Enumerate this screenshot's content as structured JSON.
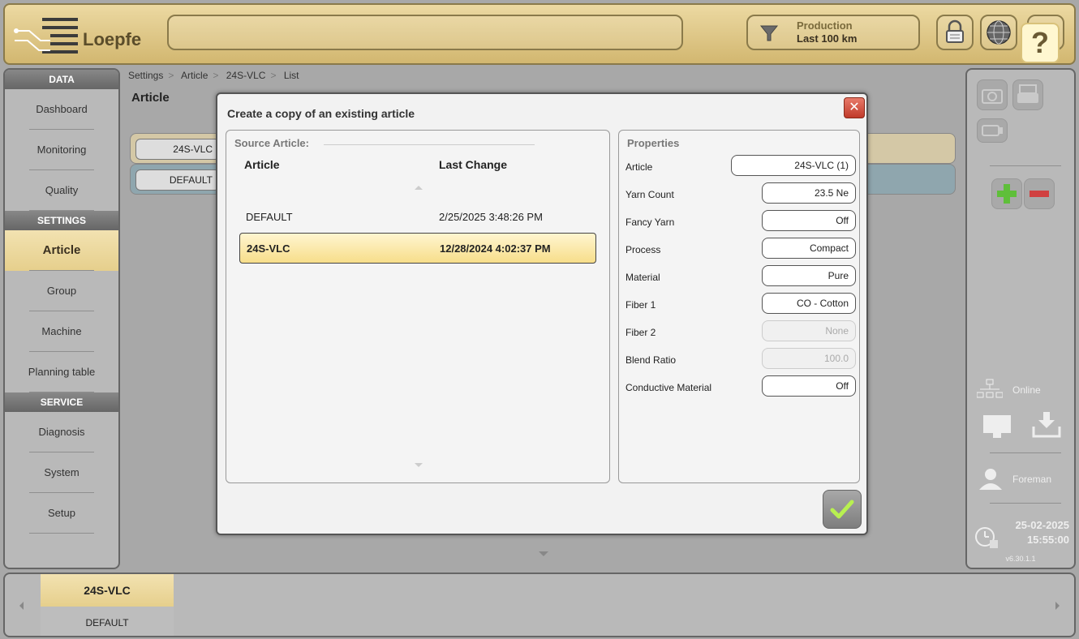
{
  "brand": {
    "name": "Loepfe"
  },
  "topbar": {
    "search_value": "",
    "filter_line1": "Production",
    "filter_line2": "Last 100 km",
    "help_label": "?"
  },
  "sidebar": {
    "sections": [
      {
        "header": "DATA",
        "items": [
          {
            "label": "Dashboard"
          },
          {
            "label": "Monitoring"
          },
          {
            "label": "Quality"
          }
        ]
      },
      {
        "header": "SETTINGS",
        "items": [
          {
            "label": "Article",
            "active": true
          },
          {
            "label": "Group"
          },
          {
            "label": "Machine"
          },
          {
            "label": "Planning table"
          }
        ]
      },
      {
        "header": "SERVICE",
        "items": [
          {
            "label": "Diagnosis"
          },
          {
            "label": "System"
          },
          {
            "label": "Setup"
          }
        ]
      }
    ]
  },
  "breadcrumb": [
    "Settings",
    "Article",
    "24S-VLC",
    "List"
  ],
  "page_title": "Article",
  "list_rows": [
    {
      "label": "24S-VLC"
    },
    {
      "label": "DEFAULT"
    }
  ],
  "dialog": {
    "title": "Create a copy of an existing article",
    "close_label": "✕",
    "source_legend": "Source Article:",
    "col_article": "Article",
    "col_last_change": "Last Change",
    "rows": [
      {
        "article": "DEFAULT",
        "last_change": "2/25/2025 3:48:26 PM",
        "selected": false
      },
      {
        "article": "24S-VLC",
        "last_change": "12/28/2024 4:02:37 PM",
        "selected": true
      }
    ],
    "properties_legend": "Properties",
    "properties": [
      {
        "label": "Article",
        "value": "24S-VLC (1)",
        "enabled": true
      },
      {
        "label": "Yarn Count",
        "value": "23.5 Ne",
        "enabled": true
      },
      {
        "label": "Fancy Yarn",
        "value": "Off",
        "enabled": true
      },
      {
        "label": "Process",
        "value": "Compact",
        "enabled": true
      },
      {
        "label": "Material",
        "value": "Pure",
        "enabled": true
      },
      {
        "label": "Fiber 1",
        "value": "CO - Cotton",
        "enabled": true
      },
      {
        "label": "Fiber 2",
        "value": "None",
        "enabled": false
      },
      {
        "label": "Blend Ratio",
        "value": "100.0",
        "enabled": false
      },
      {
        "label": "Conductive Material",
        "value": "Off",
        "enabled": true
      }
    ],
    "ok_icon": "checkmark-icon"
  },
  "rightpanel": {
    "online_label": "Online",
    "user_label": "Foreman",
    "date": "25-02-2025",
    "time": "15:55:00",
    "version": "v6.30.1.1"
  },
  "bottombar": {
    "tabs": [
      {
        "label": "24S-VLC",
        "active": true
      },
      {
        "label": "DEFAULT",
        "active": false
      }
    ]
  },
  "colors": {
    "accent": "#e6cf8c",
    "selection": "#f7de8a",
    "close": "#c03a2a",
    "ok_check": "#9be04a"
  }
}
